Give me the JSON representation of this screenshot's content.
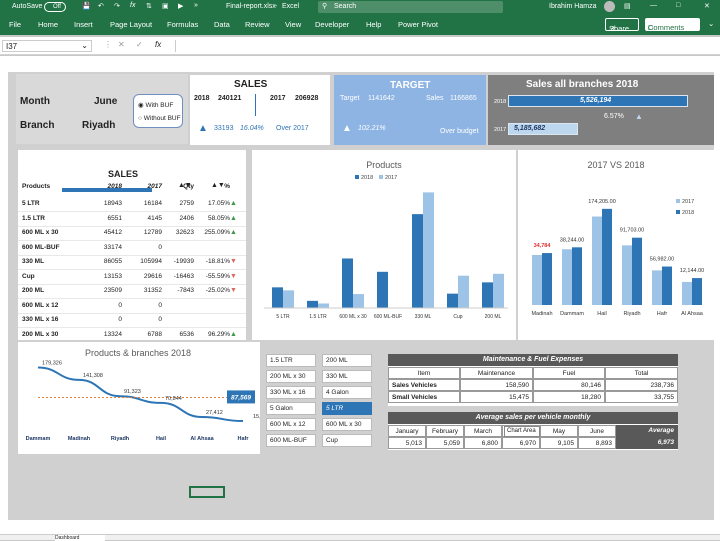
{
  "title_bar": {
    "autosave": "AutoSave",
    "autosave_state": "Off",
    "filename": "Final-report.xlsx",
    "app": "Excel",
    "search": "Search",
    "user": "Ibrahim Hamza"
  },
  "ribbon": {
    "tabs": [
      "File",
      "Home",
      "Insert",
      "Page Layout",
      "Formulas",
      "Data",
      "Review",
      "View",
      "Developer",
      "Help",
      "Power Pivot"
    ],
    "share": "Share",
    "comments": "Comments"
  },
  "formula_bar": {
    "name_box": "I37",
    "fx": "fx"
  },
  "header": {
    "month_label": "Month",
    "month_value": "June",
    "branch_label": "Branch",
    "branch_value": "Riyadh",
    "with_buf": "With BUF",
    "without_buf": "Without BUF"
  },
  "sales_card": {
    "title": "SALES",
    "y1": "2018",
    "v1": "240121",
    "y2": "2017",
    "v2": "206928",
    "diff": "33193",
    "pct": "16.04%",
    "note": "Over 2017"
  },
  "target_card": {
    "title": "TARGET",
    "target_label": "Target",
    "target_value": "1141642",
    "sales_label": "Sales",
    "sales_value": "1166865",
    "pct": "102.21%",
    "note": "Over budget"
  },
  "allbranch_card": {
    "title": "Sales all branches 2018",
    "y2018": "2018",
    "v2018": "5,526,194",
    "y2017": "2017",
    "v2017": "5,185,682",
    "pct": "6.57%",
    "v2018_fill": 1.0,
    "v2017_fill": 0.39
  },
  "sales_table": {
    "title": "SALES",
    "headers": [
      "Products",
      "2018",
      "2017",
      "Qty",
      "%"
    ],
    "rows": [
      [
        "5 LTR",
        "18943",
        "16184",
        "2759",
        "17.05%",
        "up"
      ],
      [
        "1.5 LTR",
        "6551",
        "4145",
        "2406",
        "58.05%",
        "up"
      ],
      [
        "600 ML x 30",
        "45412",
        "12789",
        "32623",
        "255.09%",
        "up"
      ],
      [
        "600 ML-BUF",
        "33174",
        "0",
        "",
        "",
        ""
      ],
      [
        "330 ML",
        "86055",
        "105994",
        "-19939",
        "-18.81%",
        "down"
      ],
      [
        "Cup",
        "13153",
        "29616",
        "-16463",
        "-55.59%",
        "down"
      ],
      [
        "200 ML",
        "23509",
        "31352",
        "-7843",
        "-25.02%",
        "down"
      ],
      [
        "600 ML x 12",
        "0",
        "0",
        "",
        "",
        ""
      ],
      [
        "330 ML x 16",
        "0",
        "0",
        "",
        "",
        ""
      ],
      [
        "200 ML x 30",
        "13324",
        "6788",
        "6536",
        "96.29%",
        "up"
      ]
    ]
  },
  "chart_data": [
    {
      "type": "bar",
      "title": "Products",
      "categories": [
        "5 LTR",
        "1.5 LTR",
        "600 ML x 30",
        "600 ML-BUF",
        "330 ML",
        "Cup",
        "200 ML"
      ],
      "series": [
        {
          "name": "2018",
          "values": [
            18943,
            6551,
            45412,
            33174,
            86055,
            13153,
            23509
          ]
        },
        {
          "name": "2017",
          "values": [
            16184,
            4145,
            12789,
            0,
            105994,
            29616,
            31352
          ]
        }
      ],
      "ylim": [
        0,
        110000
      ],
      "legend": "top"
    },
    {
      "type": "bar",
      "title": "2017 VS 2018",
      "categories": [
        "Madinah",
        "Dammam",
        "Hail",
        "Riyadh",
        "Hafr",
        "Al Ahsaa"
      ],
      "series": [
        {
          "name": "2017",
          "values": [
            130000,
            145000,
            230000,
            155000,
            90000,
            60000
          ]
        },
        {
          "name": "2018",
          "values": [
            135000,
            150000,
            250000,
            175000,
            100000,
            70000
          ]
        }
      ],
      "labels": [
        "34,784",
        "38,244.00",
        "174,205.00",
        "91,703.00",
        "56,982.00",
        "12,144.00"
      ],
      "ylim": [
        0,
        260000
      ],
      "legend": "right"
    },
    {
      "type": "line",
      "title": "Products & branches 2018",
      "categories": [
        "Dammam",
        "Madinah",
        "Riyadh",
        "Hail",
        "Al Ahsaa",
        "Hafr"
      ],
      "values": [
        179326,
        141308,
        91323,
        70844,
        27412,
        15203
      ],
      "value_labels": [
        "179,326",
        "141,308",
        "91,323",
        "70,844",
        "27,412",
        "15,203"
      ],
      "average_label": "87,569",
      "average": 87569,
      "ylim": [
        0,
        190000
      ]
    }
  ],
  "slicers": [
    "1.5 LTR",
    "200 ML",
    "200 ML x 30",
    "330 ML",
    "330 ML x 16",
    "4 Galon",
    "5 Galon",
    "5 LTR",
    "600 ML x 12",
    "600 ML x 30",
    "600 ML-BUF",
    "Cup"
  ],
  "maintenance": {
    "title": "Maintenance & Fuel Expenses",
    "headers": [
      "Item",
      "Maintenance",
      "Fuel",
      "Total"
    ],
    "rows": [
      [
        "Sales Vehicles",
        "158,590",
        "80,146",
        "238,736"
      ],
      [
        "Small Vehicles",
        "15,475",
        "18,280",
        "33,755"
      ]
    ]
  },
  "avg_vehicle": {
    "title": "Average sales per vehicle monthly",
    "months": [
      "January",
      "February",
      "March",
      "April",
      "May",
      "June"
    ],
    "values": [
      "5,013",
      "5,059",
      "6,800",
      "6,970",
      "9,105",
      "8,893"
    ],
    "avg_label": "Average",
    "avg_value": "6,973",
    "tooltip": "Chart Area"
  },
  "sheet_tab": "Dashboard"
}
